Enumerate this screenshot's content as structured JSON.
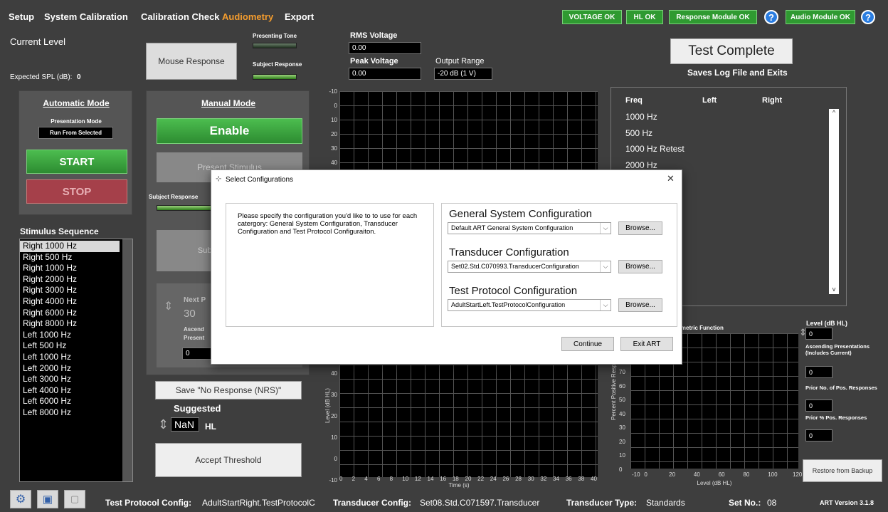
{
  "menu": {
    "setup": "Setup",
    "system_calibration": "System Calibration",
    "calibration_check": "Calibration Check",
    "audiometry": "Audiometry",
    "export": "Export"
  },
  "status": {
    "voltage": "VOLTAGE OK",
    "hl": "HL OK",
    "response_module": "Response Module OK",
    "audio_module": "Audio Module OK",
    "help": "?"
  },
  "colors": {
    "accent_orange": "#f39c2e",
    "status_green": "#2f9a31",
    "start_green": "#33a83a",
    "stop_red": "#a5404a"
  },
  "left": {
    "current_level": "Current Level",
    "expected_spl_label": "Expected SPL (dB):",
    "expected_spl_value": "0",
    "mouse_response": "Mouse Response",
    "presenting_tone": "Presenting Tone",
    "subject_response": "Subject Response"
  },
  "rms": {
    "rms_label": "RMS Voltage",
    "rms_value": "0.00",
    "peak_label": "Peak Voltage",
    "peak_value": "0.00",
    "range_label": "Output Range",
    "range_value": "-20 dB (1 V)"
  },
  "auto": {
    "title": "Automatic Mode",
    "presentation_mode_label": "Presentation Mode",
    "presentation_mode_value": "Run From Selected",
    "start": "START",
    "stop": "STOP"
  },
  "manual": {
    "title": "Manual Mode",
    "enable": "Enable",
    "present_stimulus": "Present Stimulus",
    "subject_response_label": "Subject Response",
    "subject_response_btn": "Subject Response",
    "next_label": "Next P",
    "next_value": "30",
    "ascending_label": "Ascend",
    "presentations_label": "Present",
    "asc_value": "0",
    "no_response": "Save \"No Response (NRS)\"",
    "suggested": "Suggested",
    "suggested_value": "NaN",
    "hl": "HL",
    "accept": "Accept Threshold"
  },
  "sequence": {
    "title": "Stimulus Sequence",
    "items": [
      "Right 1000 Hz",
      "Right 500 Hz",
      "Right 1000 Hz",
      "Right 2000 Hz",
      "Right 3000 Hz",
      "Right 4000 Hz",
      "Right 6000 Hz",
      "Right 8000 Hz",
      "Left 1000 Hz",
      "Left 500 Hz",
      "Left 1000 Hz",
      "Left 2000 Hz",
      "Left 3000 Hz",
      "Left 4000 Hz",
      "Left 6000 Hz",
      "Left 8000 Hz"
    ]
  },
  "test_complete": {
    "button": "Test Complete",
    "caption": "Saves Log File and Exits"
  },
  "results": {
    "col_freq": "Freq",
    "col_left": "Left",
    "col_right": "Right",
    "rows": [
      "1000 Hz",
      "500 Hz",
      "1000 Hz Retest",
      "2000 Hz"
    ]
  },
  "chart_data": [
    {
      "type": "line",
      "title": "",
      "xlabel": "Time (s)",
      "ylabel": "Level (dB HL)",
      "x_ticks": [
        "0",
        "2",
        "4",
        "6",
        "8",
        "10",
        "12",
        "14",
        "16",
        "18",
        "20",
        "22",
        "24",
        "26",
        "28",
        "30",
        "32",
        "34",
        "36",
        "38",
        "40"
      ],
      "y_ticks_top": [
        "-10",
        "0",
        "10",
        "20",
        "30",
        "40"
      ],
      "y_ticks_bottom": [
        "40",
        "30",
        "20",
        "10",
        "0",
        "-10"
      ],
      "xlim": [
        0,
        40
      ],
      "ylim": [
        -10,
        120
      ],
      "series": []
    },
    {
      "type": "scatter",
      "title": "ometric Function",
      "xlabel": "Level (dB HL)",
      "ylabel": "Percent Positive Responses",
      "x_ticks": [
        "-10",
        "0",
        "20",
        "40",
        "60",
        "80",
        "100",
        "120"
      ],
      "y_ticks": [
        "70",
        "60",
        "50",
        "40",
        "30",
        "20",
        "10",
        "0"
      ],
      "xlim": [
        -10,
        120
      ],
      "ylim": [
        0,
        100
      ],
      "series": []
    }
  ],
  "psy": {
    "level_label": "Level (dB HL)",
    "level_value": "0",
    "asc_label": "Ascending Presentations (Includes Current)",
    "asc_value": "0",
    "prior_no_label": "Prior No. of Pos. Responses",
    "prior_no_value": "0",
    "prior_pct_label": "Prior % Pos. Responses",
    "prior_pct_value": "0",
    "restore": "Restore from Backup"
  },
  "footer": {
    "tp_label": "Test Protocol Config:",
    "tp_value": "AdultStartRight.TestProtocolC",
    "tr_label": "Transducer Config:",
    "tr_value": "Set08.Std.C071597.Transducer",
    "tt_label": "Transducer Type:",
    "tt_value": "Standards",
    "set_label": "Set No.:",
    "set_value": "08",
    "version": "ART Version 3.1.8"
  },
  "dialog": {
    "title": "Select Configurations",
    "close": "✕",
    "instructions": "Please specify the configuration you'd like to to use for each catergory: General System Configuration, Transducer Configuration and Test Protocol Configuraiton.",
    "general_label": "General System Configuration",
    "general_value": "Default ART General System Configuration",
    "transducer_label": "Transducer Configuration",
    "transducer_value": "Set02.Std.C070993.TransducerConfiguration",
    "protocol_label": "Test Protocol Configuration",
    "protocol_value": "AdultStartLeft.TestProtocolConfiguration",
    "browse": "Browse...",
    "continue": "Continue",
    "exit": "Exit ART"
  }
}
